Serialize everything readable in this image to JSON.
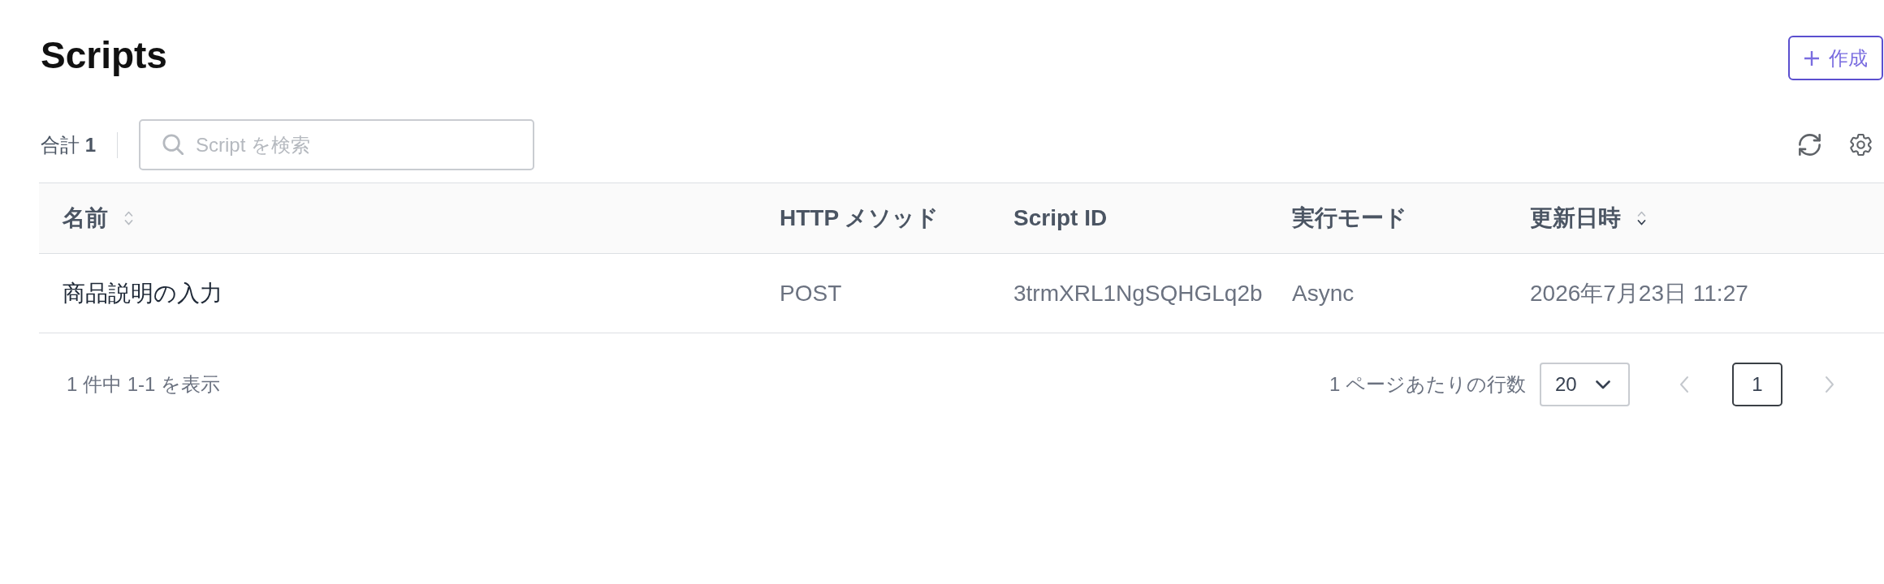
{
  "page": {
    "title": "Scripts",
    "create_button": {
      "label": "作成"
    }
  },
  "toolbar": {
    "total": "合計 **1**",
    "search": {
      "placeholder": "Script を検索"
    }
  },
  "table": {
    "columns": [
      {
        "label": "名前",
        "sortable": true,
        "sorted": false
      },
      {
        "label": "HTTP メソッド"
      },
      {
        "label": "Script ID"
      },
      {
        "label": "実行モード"
      },
      {
        "label": "更新日時",
        "sortable": true,
        "sorted": true
      }
    ],
    "rows": [
      {
        "cells": [
          "商品説明の入力",
          "POST",
          "3trmXRL1NgSQHGLq2b",
          "Async",
          "2026年7月23日 11:27"
        ]
      }
    ]
  },
  "footer": {
    "summary": "1 件中 1-1 を表示",
    "rows_per_page_label": "1 ページあたりの行数",
    "rows_per_page": "20",
    "previous": {
      "disabled": true
    },
    "pages": [
      {
        "label": "1",
        "selected": true
      }
    ],
    "next": {
      "disabled": true
    }
  }
}
